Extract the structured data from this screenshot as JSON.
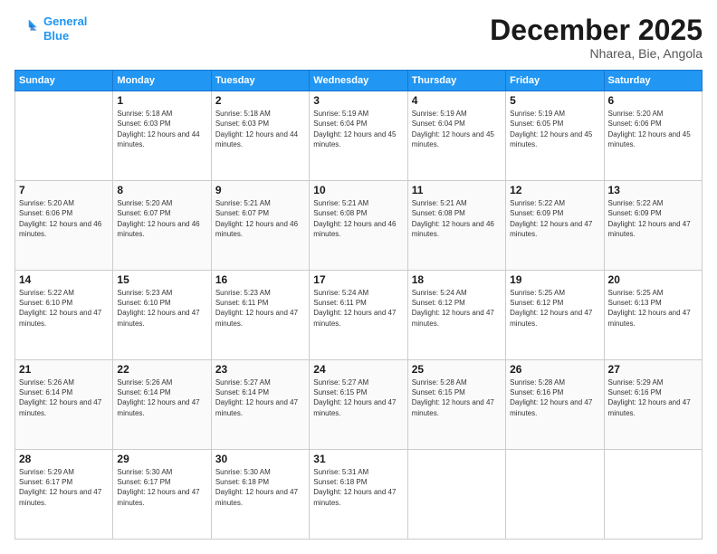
{
  "header": {
    "logo_line1": "General",
    "logo_line2": "Blue",
    "month_title": "December 2025",
    "location": "Nharea, Bie, Angola"
  },
  "days_of_week": [
    "Sunday",
    "Monday",
    "Tuesday",
    "Wednesday",
    "Thursday",
    "Friday",
    "Saturday"
  ],
  "weeks": [
    [
      {
        "day": "",
        "sunrise": "",
        "sunset": "",
        "daylight": "",
        "empty": true
      },
      {
        "day": "1",
        "sunrise": "Sunrise: 5:18 AM",
        "sunset": "Sunset: 6:03 PM",
        "daylight": "Daylight: 12 hours and 44 minutes."
      },
      {
        "day": "2",
        "sunrise": "Sunrise: 5:18 AM",
        "sunset": "Sunset: 6:03 PM",
        "daylight": "Daylight: 12 hours and 44 minutes."
      },
      {
        "day": "3",
        "sunrise": "Sunrise: 5:19 AM",
        "sunset": "Sunset: 6:04 PM",
        "daylight": "Daylight: 12 hours and 45 minutes."
      },
      {
        "day": "4",
        "sunrise": "Sunrise: 5:19 AM",
        "sunset": "Sunset: 6:04 PM",
        "daylight": "Daylight: 12 hours and 45 minutes."
      },
      {
        "day": "5",
        "sunrise": "Sunrise: 5:19 AM",
        "sunset": "Sunset: 6:05 PM",
        "daylight": "Daylight: 12 hours and 45 minutes."
      },
      {
        "day": "6",
        "sunrise": "Sunrise: 5:20 AM",
        "sunset": "Sunset: 6:06 PM",
        "daylight": "Daylight: 12 hours and 45 minutes."
      }
    ],
    [
      {
        "day": "7",
        "sunrise": "Sunrise: 5:20 AM",
        "sunset": "Sunset: 6:06 PM",
        "daylight": "Daylight: 12 hours and 46 minutes."
      },
      {
        "day": "8",
        "sunrise": "Sunrise: 5:20 AM",
        "sunset": "Sunset: 6:07 PM",
        "daylight": "Daylight: 12 hours and 46 minutes."
      },
      {
        "day": "9",
        "sunrise": "Sunrise: 5:21 AM",
        "sunset": "Sunset: 6:07 PM",
        "daylight": "Daylight: 12 hours and 46 minutes."
      },
      {
        "day": "10",
        "sunrise": "Sunrise: 5:21 AM",
        "sunset": "Sunset: 6:08 PM",
        "daylight": "Daylight: 12 hours and 46 minutes."
      },
      {
        "day": "11",
        "sunrise": "Sunrise: 5:21 AM",
        "sunset": "Sunset: 6:08 PM",
        "daylight": "Daylight: 12 hours and 46 minutes."
      },
      {
        "day": "12",
        "sunrise": "Sunrise: 5:22 AM",
        "sunset": "Sunset: 6:09 PM",
        "daylight": "Daylight: 12 hours and 47 minutes."
      },
      {
        "day": "13",
        "sunrise": "Sunrise: 5:22 AM",
        "sunset": "Sunset: 6:09 PM",
        "daylight": "Daylight: 12 hours and 47 minutes."
      }
    ],
    [
      {
        "day": "14",
        "sunrise": "Sunrise: 5:22 AM",
        "sunset": "Sunset: 6:10 PM",
        "daylight": "Daylight: 12 hours and 47 minutes."
      },
      {
        "day": "15",
        "sunrise": "Sunrise: 5:23 AM",
        "sunset": "Sunset: 6:10 PM",
        "daylight": "Daylight: 12 hours and 47 minutes."
      },
      {
        "day": "16",
        "sunrise": "Sunrise: 5:23 AM",
        "sunset": "Sunset: 6:11 PM",
        "daylight": "Daylight: 12 hours and 47 minutes."
      },
      {
        "day": "17",
        "sunrise": "Sunrise: 5:24 AM",
        "sunset": "Sunset: 6:11 PM",
        "daylight": "Daylight: 12 hours and 47 minutes."
      },
      {
        "day": "18",
        "sunrise": "Sunrise: 5:24 AM",
        "sunset": "Sunset: 6:12 PM",
        "daylight": "Daylight: 12 hours and 47 minutes."
      },
      {
        "day": "19",
        "sunrise": "Sunrise: 5:25 AM",
        "sunset": "Sunset: 6:12 PM",
        "daylight": "Daylight: 12 hours and 47 minutes."
      },
      {
        "day": "20",
        "sunrise": "Sunrise: 5:25 AM",
        "sunset": "Sunset: 6:13 PM",
        "daylight": "Daylight: 12 hours and 47 minutes."
      }
    ],
    [
      {
        "day": "21",
        "sunrise": "Sunrise: 5:26 AM",
        "sunset": "Sunset: 6:14 PM",
        "daylight": "Daylight: 12 hours and 47 minutes."
      },
      {
        "day": "22",
        "sunrise": "Sunrise: 5:26 AM",
        "sunset": "Sunset: 6:14 PM",
        "daylight": "Daylight: 12 hours and 47 minutes."
      },
      {
        "day": "23",
        "sunrise": "Sunrise: 5:27 AM",
        "sunset": "Sunset: 6:14 PM",
        "daylight": "Daylight: 12 hours and 47 minutes."
      },
      {
        "day": "24",
        "sunrise": "Sunrise: 5:27 AM",
        "sunset": "Sunset: 6:15 PM",
        "daylight": "Daylight: 12 hours and 47 minutes."
      },
      {
        "day": "25",
        "sunrise": "Sunrise: 5:28 AM",
        "sunset": "Sunset: 6:15 PM",
        "daylight": "Daylight: 12 hours and 47 minutes."
      },
      {
        "day": "26",
        "sunrise": "Sunrise: 5:28 AM",
        "sunset": "Sunset: 6:16 PM",
        "daylight": "Daylight: 12 hours and 47 minutes."
      },
      {
        "day": "27",
        "sunrise": "Sunrise: 5:29 AM",
        "sunset": "Sunset: 6:16 PM",
        "daylight": "Daylight: 12 hours and 47 minutes."
      }
    ],
    [
      {
        "day": "28",
        "sunrise": "Sunrise: 5:29 AM",
        "sunset": "Sunset: 6:17 PM",
        "daylight": "Daylight: 12 hours and 47 minutes."
      },
      {
        "day": "29",
        "sunrise": "Sunrise: 5:30 AM",
        "sunset": "Sunset: 6:17 PM",
        "daylight": "Daylight: 12 hours and 47 minutes."
      },
      {
        "day": "30",
        "sunrise": "Sunrise: 5:30 AM",
        "sunset": "Sunset: 6:18 PM",
        "daylight": "Daylight: 12 hours and 47 minutes."
      },
      {
        "day": "31",
        "sunrise": "Sunrise: 5:31 AM",
        "sunset": "Sunset: 6:18 PM",
        "daylight": "Daylight: 12 hours and 47 minutes."
      },
      {
        "day": "",
        "empty": true
      },
      {
        "day": "",
        "empty": true
      },
      {
        "day": "",
        "empty": true
      }
    ]
  ]
}
